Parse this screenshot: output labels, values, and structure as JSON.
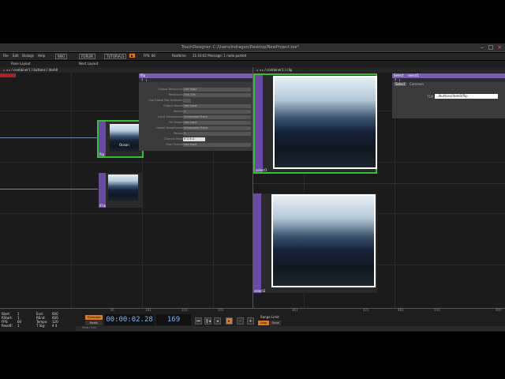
{
  "window": {
    "title": "TouchDesigner: C:/Users/Indragon/Desktop/NewProject.toe*"
  },
  "menubar": {
    "items": [
      "File",
      "Edit",
      "Dialogs",
      "Help"
    ],
    "buttons": [
      "WIKI",
      "FORUM",
      "TUTORIALS"
    ],
    "fps_label": "FPS: 60",
    "realtime_label": "Realtime",
    "message": "21:16:02 Message: 1 node posted"
  },
  "layoutbar": {
    "left": "Pane Layout",
    "right": "Next Layout"
  },
  "network": {
    "path": "/ container1 / buttons / item0",
    "nodes": [
      {
        "name": "flip",
        "caption": "Ocean"
      },
      {
        "name": "iFlip",
        "caption": ""
      }
    ]
  },
  "param_panel": {
    "header": "flip",
    "rows": [
      {
        "key": "Output Resolution",
        "value": "Use Input"
      },
      {
        "key": "Resolution",
        "value": "256 256"
      },
      {
        "key": "Use Global Res Multiplier",
        "value": ""
      },
      {
        "key": "Output Aspect",
        "value": "Use Input"
      },
      {
        "key": "Aspect",
        "value": "1"
      },
      {
        "key": "Input Smoothness",
        "value": "Interpolate Pixels"
      },
      {
        "key": "Fill Viewer",
        "value": "Use Input"
      },
      {
        "key": "Viewer Smoothness",
        "value": "Interpolate Pixels"
      },
      {
        "key": "Passes",
        "value": "1"
      },
      {
        "key": "Channel Mask",
        "value": "R G B A"
      },
      {
        "key": "Pixel Format",
        "value": "Use Input"
      }
    ]
  },
  "viewer_pane": {
    "path": "/ container1 / clip",
    "nodes": [
      {
        "name": "select1"
      },
      {
        "name": "select2"
      }
    ]
  },
  "select_panel": {
    "header": "Select",
    "op_name": "select1",
    "tabs": [
      "Select",
      "Common"
    ],
    "field_key": "TOP",
    "field_value": "../buttons/item0/flip"
  },
  "timeline": {
    "stats": [
      {
        "k": "Start:",
        "v": "1"
      },
      {
        "k": "End:",
        "v": "600"
      },
      {
        "k": "RStart:",
        "v": "1"
      },
      {
        "k": "REnd:",
        "v": "600"
      },
      {
        "k": "FPS:",
        "v": "60"
      },
      {
        "k": "Tempo:",
        "v": "120"
      },
      {
        "k": "ResetF:",
        "v": "1"
      },
      {
        "k": "T Sig:",
        "v": "4  4"
      }
    ],
    "timecode_label": "Timecode",
    "beats_label": "Beats",
    "timecode": "00:00:02.28",
    "frame": "169",
    "range_limit_label": "Range Limit",
    "loop_label": "Loop",
    "once_label": "Once",
    "ticks": [
      "91",
      "181",
      "241",
      "301",
      "361",
      "421",
      "481",
      "541",
      "600"
    ],
    "view_label": "View (Full)"
  },
  "colors": {
    "accent_purple": "#7b5bb8",
    "selection_green": "#2fc42f",
    "timeline_orange": "#e07a1e"
  }
}
